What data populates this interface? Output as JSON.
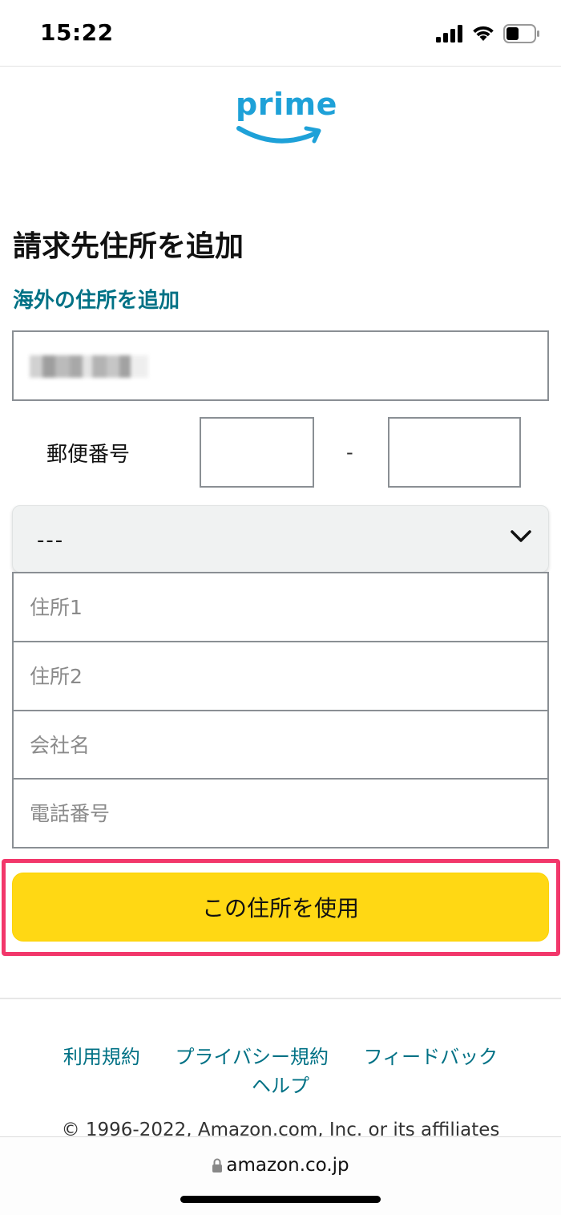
{
  "status_bar": {
    "time": "15:22",
    "icons": [
      "signal-icon",
      "wifi-icon",
      "battery-icon"
    ]
  },
  "logo": {
    "text": "prime",
    "color": "#1EA1D8"
  },
  "form": {
    "title": "請求先住所を追加",
    "overseas_link": "海外の住所を追加",
    "name_field": {
      "value": "",
      "redacted": true
    },
    "postal": {
      "label": "郵便番号",
      "separator": "-",
      "first": "",
      "second": ""
    },
    "prefecture": {
      "selected": "---"
    },
    "address1_placeholder": "住所1",
    "address2_placeholder": "住所2",
    "company_placeholder": "会社名",
    "phone_placeholder": "電話番号",
    "submit_label": "この住所を使用"
  },
  "footer": {
    "links": [
      "利用規約",
      "プライバシー規約",
      "フィードバック",
      "ヘルプ"
    ],
    "copyright": "© 1996-2022, Amazon.com, Inc. or its affiliates"
  },
  "browser": {
    "url": "amazon.co.jp"
  },
  "colors": {
    "link": "#007185",
    "button": "#FFD814",
    "highlight": "#F2376B"
  }
}
